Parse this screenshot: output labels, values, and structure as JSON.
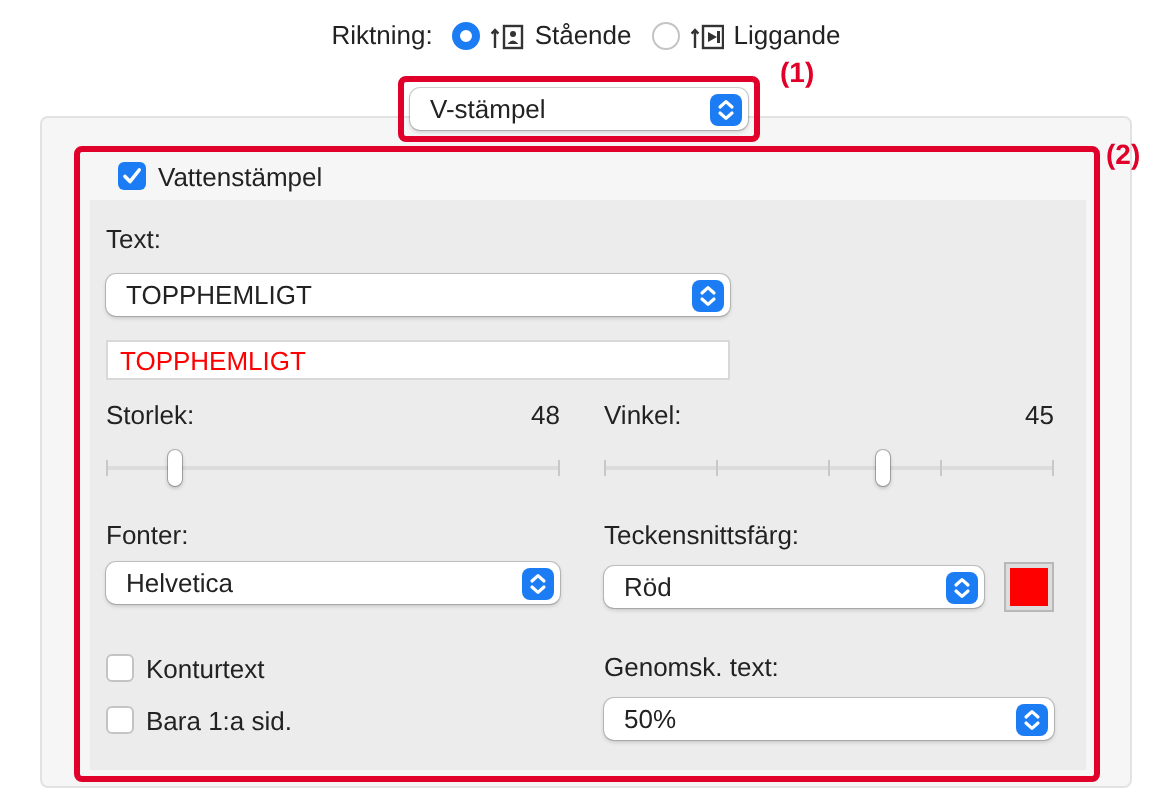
{
  "orientation": {
    "label": "Riktning:",
    "options": [
      {
        "label": "Stående",
        "kind": "portrait",
        "selected": true
      },
      {
        "label": "Liggande",
        "kind": "landscape",
        "selected": false
      }
    ]
  },
  "mode_select": {
    "value": "V-stämpel",
    "callout": "(1)"
  },
  "watermark": {
    "label": "Vattenstämpel",
    "checked": true,
    "callout": "(2)",
    "text_label": "Text:",
    "text_select": "TOPPHEMLIGT",
    "text_field": "TOPPHEMLIGT",
    "sliders": [
      {
        "label": "Storlek:",
        "reading": "48",
        "level": 0.15,
        "kind": "plain"
      },
      {
        "label": "Vinkel:",
        "reading": "45",
        "level": 0.62,
        "kind": "ticked"
      }
    ],
    "font": {
      "label": "Fonter:",
      "value": "Helvetica"
    },
    "font_color": {
      "label": "Teckensnittsfärg:",
      "value": "Röd",
      "color": "#ff0000"
    },
    "options": [
      {
        "label": "Konturtext",
        "checked": false
      },
      {
        "label": "Bara 1:a sid.",
        "checked": false
      }
    ],
    "transparency": {
      "label": "Genomsk. text:",
      "value": "50%"
    }
  }
}
